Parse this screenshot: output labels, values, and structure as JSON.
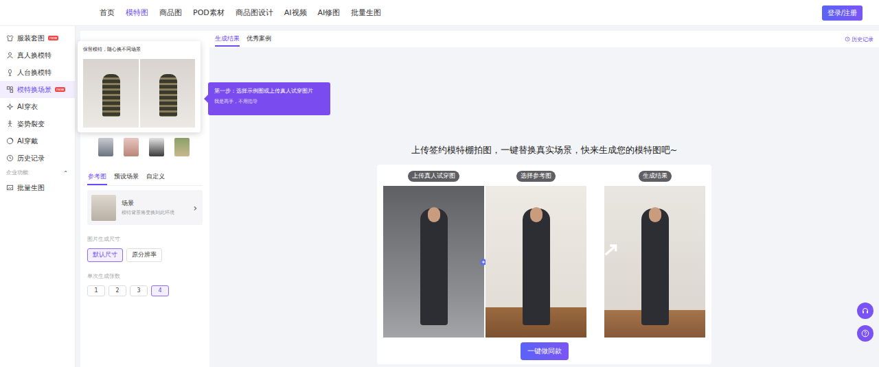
{
  "nav": {
    "items": [
      {
        "label": "首页",
        "selected": false
      },
      {
        "label": "模特图",
        "selected": true
      },
      {
        "label": "商品图",
        "selected": false
      },
      {
        "label": "POD素材",
        "selected": false
      },
      {
        "label": "商品图设计",
        "selected": false
      },
      {
        "label": "AI视频",
        "selected": false
      },
      {
        "label": "AI修图",
        "selected": false
      },
      {
        "label": "批量生图",
        "selected": false
      }
    ],
    "login": "登录/注册"
  },
  "sidebar": {
    "items": [
      {
        "label": "服装套图",
        "badge": "new",
        "selected": false
      },
      {
        "label": "真人换模特",
        "badge": "",
        "selected": false
      },
      {
        "label": "人台换模特",
        "badge": "",
        "selected": false
      },
      {
        "label": "模特换场景",
        "badge": "new",
        "selected": true
      },
      {
        "label": "AI穿衣",
        "badge": "",
        "selected": false
      },
      {
        "label": "姿势裂变",
        "badge": "",
        "selected": false
      },
      {
        "label": "AI穿戴",
        "badge": "",
        "selected": false
      },
      {
        "label": "历史记录",
        "badge": "",
        "selected": false
      }
    ],
    "section": {
      "label": "企业功能",
      "toggle": "⌃",
      "expanded": true,
      "items": [
        {
          "label": "批量生图",
          "selected": false
        }
      ]
    }
  },
  "guide_card": {
    "title": "保留模特，随心换不同场景"
  },
  "guide_tip": {
    "title": "第一步：选择示例图或上传真人试穿图片",
    "skip": "我是高手，不用指导"
  },
  "ref_tabs": [
    {
      "label": "参考图",
      "selected": true
    },
    {
      "label": "预设场景",
      "selected": false
    },
    {
      "label": "自定义",
      "selected": false
    }
  ],
  "scene_card": {
    "title": "场景",
    "desc": "模特背景将变换到此环境",
    "arrow": "›"
  },
  "size": {
    "label": "图片生成尺寸",
    "options": [
      {
        "label": "默认尺寸",
        "selected": true
      },
      {
        "label": "原分辨率",
        "selected": false
      }
    ]
  },
  "count": {
    "label": "单次生成张数",
    "options": [
      {
        "label": "1",
        "selected": false
      },
      {
        "label": "2",
        "selected": false
      },
      {
        "label": "3",
        "selected": false
      },
      {
        "label": "4",
        "selected": true
      }
    ]
  },
  "main": {
    "tabs": [
      {
        "label": "生成结果",
        "selected": true
      },
      {
        "label": "优秀案例",
        "selected": false
      }
    ],
    "history": "历史记录",
    "headline": "上传签约模特棚拍图，一键替换真实场景，快来生成您的模特图吧~",
    "steps": [
      {
        "label": "上传真人试穿图"
      },
      {
        "label": "选择参考图"
      },
      {
        "label": "生成结果"
      }
    ],
    "button": "一键做同款"
  }
}
